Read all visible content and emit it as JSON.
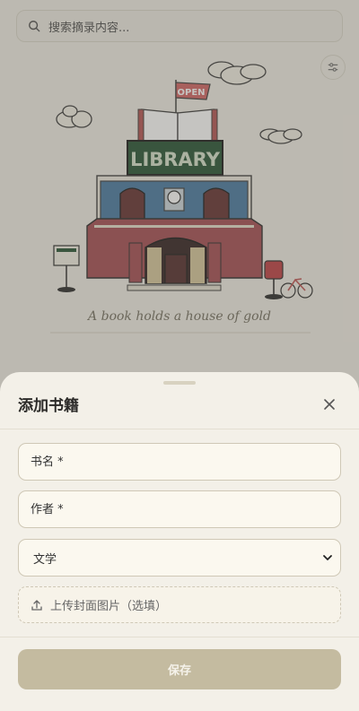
{
  "search": {
    "placeholder": "搜索摘录内容..."
  },
  "hero": {
    "sign_open": "OPEN",
    "sign_library": "LIBRARY",
    "tagline": "A book holds a house of gold"
  },
  "sheet": {
    "title": "添加书籍",
    "fields": {
      "title_placeholder": "书名 *",
      "author_placeholder": "作者 *",
      "category_value": "文学"
    },
    "upload_label": "上传封面图片（选填）",
    "save_label": "保存"
  },
  "colors": {
    "accent": "#c4bba0",
    "sheet_bg": "#f3f0e8",
    "field_bg": "#fbf8ef",
    "field_border": "#cfc8b6"
  },
  "icons": [
    "search-icon",
    "filter-icon",
    "close-icon",
    "upload-icon",
    "chevron-down-icon"
  ]
}
